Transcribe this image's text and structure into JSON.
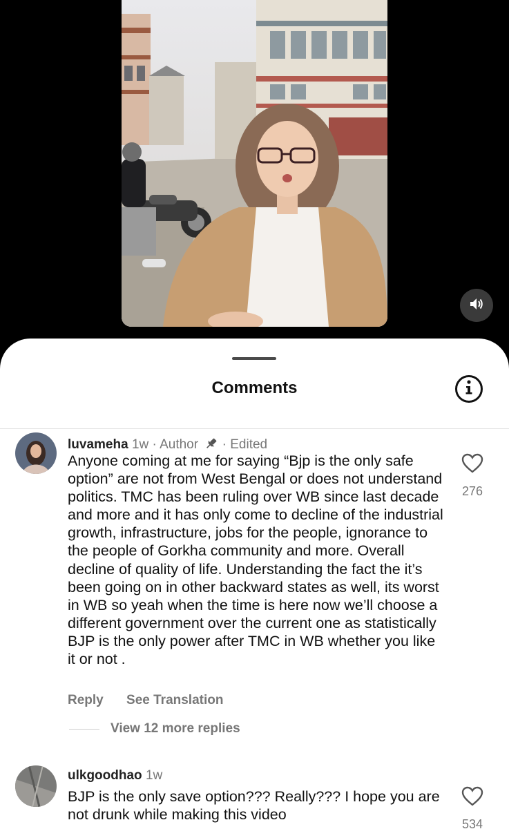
{
  "video": {
    "sound_icon": "speaker-icon"
  },
  "sheet": {
    "title": "Comments",
    "info_icon": "info-icon"
  },
  "comments": [
    {
      "username": "luvameha",
      "time": "1w",
      "author_badge": "Author",
      "edited": "Edited",
      "text": "Anyone coming at me for saying “Bjp is the only safe option” are not from West Bengal or does not understand politics. TMC has been ruling over WB since last decade and more and it has only come to decline of the industrial growth, infrastructure, jobs for the people, ignorance to the people of Gorkha community and more. Overall decline of quality of life. Understanding the fact the it’s been going on in other backward states as well, its worst in WB so yeah when the time is here now we’ll choose a different government over the current one as statistically BJP is the only power after TMC in WB whether you like it or not .",
      "likes": "276",
      "reply_label": "Reply",
      "translate_label": "See Translation",
      "view_replies": "View 12 more replies"
    },
    {
      "username": "ulkgoodhao",
      "time": "1w",
      "text": "BJP is the only save option??? Really??? I hope you are not drunk while making this video",
      "likes": "534"
    }
  ]
}
